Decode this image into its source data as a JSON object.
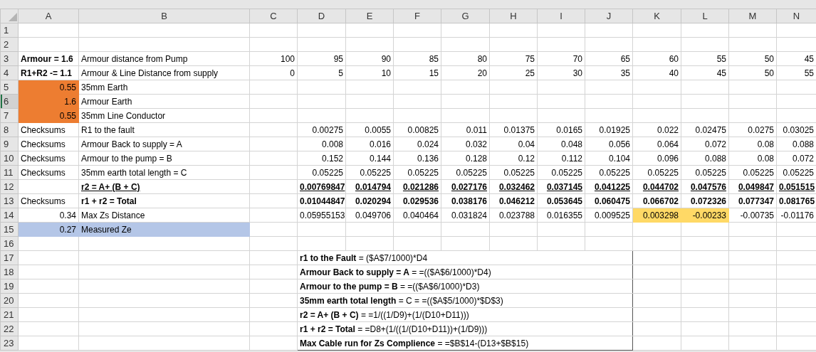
{
  "columns": [
    "A",
    "B",
    "C",
    "D",
    "E",
    "F",
    "G",
    "H",
    "I",
    "J",
    "K",
    "L",
    "M",
    "N"
  ],
  "rows": [
    {
      "number": "1",
      "selected": false,
      "cells": [
        null,
        null,
        null,
        null,
        null,
        null,
        null,
        null,
        null,
        null,
        null,
        null,
        null,
        null
      ]
    },
    {
      "number": "2",
      "selected": false,
      "cells": [
        null,
        null,
        null,
        null,
        null,
        null,
        null,
        null,
        null,
        null,
        null,
        null,
        null,
        null
      ]
    },
    {
      "number": "3",
      "selected": false,
      "cells": [
        {
          "text": "Armour = 1.6",
          "kind": "label-bold"
        },
        {
          "text": "Armour distance from Pump",
          "kind": "label"
        },
        {
          "text": "100",
          "kind": "number"
        },
        {
          "text": "95",
          "kind": "number"
        },
        {
          "text": "90",
          "kind": "number"
        },
        {
          "text": "85",
          "kind": "number"
        },
        {
          "text": "80",
          "kind": "number"
        },
        {
          "text": "75",
          "kind": "number"
        },
        {
          "text": "70",
          "kind": "number"
        },
        {
          "text": "65",
          "kind": "number"
        },
        {
          "text": "60",
          "kind": "number"
        },
        {
          "text": "55",
          "kind": "number"
        },
        {
          "text": "50",
          "kind": "number"
        },
        {
          "text": "45",
          "kind": "number"
        }
      ]
    },
    {
      "number": "4",
      "selected": false,
      "cells": [
        {
          "text": "R1+R2 -= 1.1",
          "kind": "label-bold"
        },
        {
          "text": "Armour & Line Distance from supply",
          "kind": "label"
        },
        {
          "text": "0",
          "kind": "number"
        },
        {
          "text": "5",
          "kind": "number"
        },
        {
          "text": "10",
          "kind": "number"
        },
        {
          "text": "15",
          "kind": "number"
        },
        {
          "text": "20",
          "kind": "number"
        },
        {
          "text": "25",
          "kind": "number"
        },
        {
          "text": "30",
          "kind": "number"
        },
        {
          "text": "35",
          "kind": "number"
        },
        {
          "text": "40",
          "kind": "number"
        },
        {
          "text": "45",
          "kind": "number"
        },
        {
          "text": "50",
          "kind": "number"
        },
        {
          "text": "55",
          "kind": "number"
        }
      ]
    },
    {
      "number": "5",
      "selected": false,
      "cells": [
        {
          "text": "0.55",
          "kind": "number",
          "color": "#ed7d31"
        },
        {
          "text": "35mm Earth",
          "kind": "label"
        },
        null,
        null,
        null,
        null,
        null,
        null,
        null,
        null,
        null,
        null,
        null,
        null
      ]
    },
    {
      "number": "6",
      "selected": true,
      "cells": [
        {
          "text": "1.6",
          "kind": "number",
          "color": "#ed7d31"
        },
        {
          "text": "Armour Earth",
          "kind": "label"
        },
        null,
        null,
        null,
        null,
        null,
        null,
        null,
        null,
        null,
        null,
        null,
        null
      ]
    },
    {
      "number": "7",
      "selected": false,
      "cells": [
        {
          "text": "0.55",
          "kind": "number",
          "color": "#ed7d31"
        },
        {
          "text": "35mm Line Conductor",
          "kind": "label"
        },
        null,
        null,
        null,
        null,
        null,
        null,
        null,
        null,
        null,
        null,
        null,
        null
      ]
    },
    {
      "number": "8",
      "selected": false,
      "cells": [
        {
          "text": "Checksums",
          "kind": "label"
        },
        {
          "text": "R1 to the fault",
          "kind": "label"
        },
        null,
        {
          "text": "0.00275",
          "kind": "number"
        },
        {
          "text": "0.0055",
          "kind": "number"
        },
        {
          "text": "0.00825",
          "kind": "number"
        },
        {
          "text": "0.011",
          "kind": "number"
        },
        {
          "text": "0.01375",
          "kind": "number"
        },
        {
          "text": "0.0165",
          "kind": "number"
        },
        {
          "text": "0.01925",
          "kind": "number"
        },
        {
          "text": "0.022",
          "kind": "number"
        },
        {
          "text": "0.02475",
          "kind": "number"
        },
        {
          "text": "0.0275",
          "kind": "number"
        },
        {
          "text": "0.03025",
          "kind": "number"
        }
      ]
    },
    {
      "number": "9",
      "selected": false,
      "cells": [
        {
          "text": "Checksums",
          "kind": "label"
        },
        {
          "text": "Armour Back to supply = A",
          "kind": "label"
        },
        null,
        {
          "text": "0.008",
          "kind": "number"
        },
        {
          "text": "0.016",
          "kind": "number"
        },
        {
          "text": "0.024",
          "kind": "number"
        },
        {
          "text": "0.032",
          "kind": "number"
        },
        {
          "text": "0.04",
          "kind": "number"
        },
        {
          "text": "0.048",
          "kind": "number"
        },
        {
          "text": "0.056",
          "kind": "number"
        },
        {
          "text": "0.064",
          "kind": "number"
        },
        {
          "text": "0.072",
          "kind": "number"
        },
        {
          "text": "0.08",
          "kind": "number"
        },
        {
          "text": "0.088",
          "kind": "number"
        }
      ]
    },
    {
      "number": "10",
      "selected": false,
      "cells": [
        {
          "text": "Checksums",
          "kind": "label"
        },
        {
          "text": "Armour to the pump = B",
          "kind": "label"
        },
        null,
        {
          "text": "0.152",
          "kind": "number"
        },
        {
          "text": "0.144",
          "kind": "number"
        },
        {
          "text": "0.136",
          "kind": "number"
        },
        {
          "text": "0.128",
          "kind": "number"
        },
        {
          "text": "0.12",
          "kind": "number"
        },
        {
          "text": "0.112",
          "kind": "number"
        },
        {
          "text": "0.104",
          "kind": "number"
        },
        {
          "text": "0.096",
          "kind": "number"
        },
        {
          "text": "0.088",
          "kind": "number"
        },
        {
          "text": "0.08",
          "kind": "number"
        },
        {
          "text": "0.072",
          "kind": "number"
        }
      ]
    },
    {
      "number": "11",
      "selected": false,
      "cells": [
        {
          "text": "Checksums",
          "kind": "label"
        },
        {
          "text": "35mm earth total length = C",
          "kind": "label"
        },
        null,
        {
          "text": "0.05225",
          "kind": "number"
        },
        {
          "text": "0.05225",
          "kind": "number"
        },
        {
          "text": "0.05225",
          "kind": "number"
        },
        {
          "text": "0.05225",
          "kind": "number"
        },
        {
          "text": "0.05225",
          "kind": "number"
        },
        {
          "text": "0.05225",
          "kind": "number"
        },
        {
          "text": "0.05225",
          "kind": "number"
        },
        {
          "text": "0.05225",
          "kind": "number"
        },
        {
          "text": "0.05225",
          "kind": "number"
        },
        {
          "text": "0.05225",
          "kind": "number"
        },
        {
          "text": "0.05225",
          "kind": "number"
        }
      ]
    },
    {
      "number": "12",
      "selected": false,
      "cells": [
        null,
        {
          "text": "r2 = A+ (B + C)",
          "kind": "label-bold-underline"
        },
        null,
        {
          "text": "0.00769847",
          "kind": "number-bold-underline"
        },
        {
          "text": "0.014794",
          "kind": "number-bold-underline"
        },
        {
          "text": "0.021286",
          "kind": "number-bold-underline"
        },
        {
          "text": "0.027176",
          "kind": "number-bold-underline"
        },
        {
          "text": "0.032462",
          "kind": "number-bold-underline"
        },
        {
          "text": "0.037145",
          "kind": "number-bold-underline"
        },
        {
          "text": "0.041225",
          "kind": "number-bold-underline"
        },
        {
          "text": "0.044702",
          "kind": "number-bold-underline"
        },
        {
          "text": "0.047576",
          "kind": "number-bold-underline"
        },
        {
          "text": "0.049847",
          "kind": "number-bold-underline"
        },
        {
          "text": "0.051515",
          "kind": "number-bold-underline"
        }
      ]
    },
    {
      "number": "13",
      "selected": false,
      "cells": [
        {
          "text": "Checksums",
          "kind": "label"
        },
        {
          "text": "r1 + r2 = Total",
          "kind": "label-bold"
        },
        null,
        {
          "text": "0.01044847",
          "kind": "number-bold"
        },
        {
          "text": "0.020294",
          "kind": "number-bold"
        },
        {
          "text": "0.029536",
          "kind": "number-bold"
        },
        {
          "text": "0.038176",
          "kind": "number-bold"
        },
        {
          "text": "0.046212",
          "kind": "number-bold"
        },
        {
          "text": "0.053645",
          "kind": "number-bold"
        },
        {
          "text": "0.060475",
          "kind": "number-bold"
        },
        {
          "text": "0.066702",
          "kind": "number-bold"
        },
        {
          "text": "0.072326",
          "kind": "number-bold"
        },
        {
          "text": "0.077347",
          "kind": "number-bold"
        },
        {
          "text": "0.081765",
          "kind": "number-bold"
        }
      ]
    },
    {
      "number": "14",
      "selected": false,
      "cells": [
        {
          "text": "0.34",
          "kind": "number"
        },
        {
          "text": "Max Zs Distance",
          "kind": "label"
        },
        null,
        {
          "text": "0.05955153",
          "kind": "number"
        },
        {
          "text": "0.049706",
          "kind": "number"
        },
        {
          "text": "0.040464",
          "kind": "number"
        },
        {
          "text": "0.031824",
          "kind": "number"
        },
        {
          "text": "0.023788",
          "kind": "number"
        },
        {
          "text": "0.016355",
          "kind": "number"
        },
        {
          "text": "0.009525",
          "kind": "number"
        },
        {
          "text": "0.003298",
          "kind": "number",
          "color": "#ffd966"
        },
        {
          "text": "-0.00233",
          "kind": "number",
          "color": "#ffd966"
        },
        {
          "text": "-0.00735",
          "kind": "number"
        },
        {
          "text": "-0.01176",
          "kind": "number"
        }
      ]
    },
    {
      "number": "15",
      "selected": false,
      "cells": [
        {
          "text": "0.27",
          "kind": "number",
          "color": "#b4c6e7"
        },
        {
          "text": "Measured Ze",
          "kind": "label",
          "color": "#b4c6e7"
        },
        null,
        null,
        null,
        null,
        null,
        null,
        null,
        null,
        null,
        null,
        null,
        null
      ]
    },
    {
      "number": "16",
      "selected": false,
      "cells": [
        null,
        null,
        null,
        null,
        null,
        null,
        null,
        null,
        null,
        null,
        null,
        null,
        null,
        null
      ]
    },
    {
      "number": "17",
      "selected": false,
      "cells": [
        null,
        null,
        null,
        {
          "text": "**r1 to the Fault** = ($A$7/1000)*D4",
          "kind": "note"
        },
        null,
        null,
        null,
        null
      ]
    },
    {
      "number": "18",
      "selected": false,
      "cells": [
        null,
        null,
        null,
        {
          "text": "**Armour Back to supply = A** = =(($A$6/1000)*D4)",
          "kind": "note"
        },
        null,
        null,
        null,
        null
      ]
    },
    {
      "number": "19",
      "selected": false,
      "cells": [
        null,
        null,
        null,
        {
          "text": "**Armour to the pump = B** = =(($A$6/1000)*D3)",
          "kind": "note"
        },
        null,
        null,
        null,
        null
      ]
    },
    {
      "number": "20",
      "selected": false,
      "cells": [
        null,
        null,
        null,
        {
          "text": "**35mm earth total length** = C = =(($A$5/1000)*$D$3)",
          "kind": "note"
        },
        null,
        null,
        null,
        null
      ]
    },
    {
      "number": "21",
      "selected": false,
      "cells": [
        null,
        null,
        null,
        {
          "text": "**r2 = A+ (B + C)** = =1/((1/D9)+(1/(D10+D11)))",
          "kind": "note"
        },
        null,
        null,
        null,
        null
      ]
    },
    {
      "number": "22",
      "selected": false,
      "cells": [
        null,
        null,
        null,
        {
          "text": "**r1 + r2 = Total** = =D8+(1/((1/(D10+D11))+(1/D9)))",
          "kind": "note"
        },
        null,
        null,
        null,
        null
      ]
    },
    {
      "number": "23",
      "selected": false,
      "cells": [
        null,
        null,
        null,
        {
          "text": "**Max Cable run for Zs Complience** = =$B$14-(D13+$B$15)",
          "kind": "note"
        },
        null,
        null,
        null,
        null
      ]
    }
  ]
}
